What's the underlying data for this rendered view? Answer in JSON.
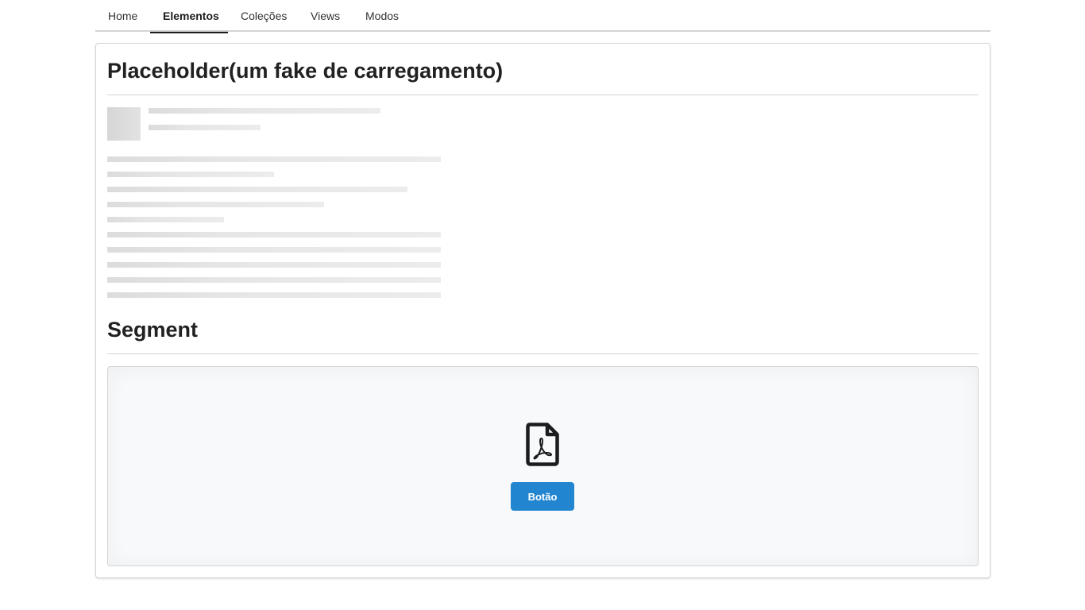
{
  "nav": {
    "tabs": [
      {
        "label": "Home",
        "active": false
      },
      {
        "label": "Elementos",
        "active": true
      },
      {
        "label": "Coleções",
        "active": false
      },
      {
        "label": "Views",
        "active": false
      },
      {
        "label": "Modos",
        "active": false
      }
    ]
  },
  "placeholder_section": {
    "title": "Placeholder(um fake de carregamento)"
  },
  "segment_section": {
    "title": "Segment",
    "icon": "file-pdf-icon",
    "button_label": "Botão"
  },
  "colors": {
    "accent": "#2185d0",
    "border": "#d4d4d5",
    "segment_bg": "#f8f9fa",
    "placeholder": "#e0e0e0"
  }
}
